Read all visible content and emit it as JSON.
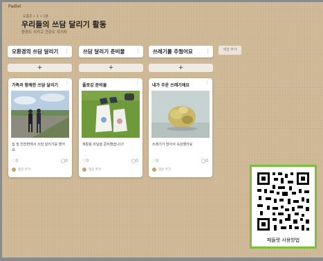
{
  "app": {
    "brand": "Padlet"
  },
  "header": {
    "breadcrumb": "오름초 • 1 • 1분",
    "title": "우리들의 쓰담 달리기 활동",
    "subtitle": "환경도 지키고 건강도 지키자"
  },
  "columns": [
    {
      "title": "오환경의 쓰담 달리기",
      "add_label": "+",
      "post": {
        "title": "가족과 함께한 쓰담 달리기",
        "body": "집 앞 천천변에서 쓰담 달리기를 했어요.",
        "likes": "0",
        "comments": "0",
        "add_comment": "댓글 추가",
        "image": "family-running-photo"
      }
    },
    {
      "title": "쓰담 달리기 준비물",
      "add_label": "+",
      "post": {
        "title": "플로깅 준비물",
        "body": "재활용 비닐을 준비했습니다!",
        "likes": "0",
        "comments": "0",
        "add_comment": "댓글 추가",
        "image": "plogging-supplies-photo"
      }
    },
    {
      "title": "쓰레기를 주웠어요",
      "add_label": "+",
      "post": {
        "title": "내가 주운 쓰레기에요",
        "body": "쓰레기가 많아서 속상했어요",
        "likes": "0",
        "comments": "0",
        "add_comment": "댓글 추가",
        "image": "trash-photo"
      }
    }
  ],
  "add_column_label": "섹션 추가",
  "qr": {
    "caption": "패들렛 사용방법"
  },
  "colors": {
    "background": "#cfb896",
    "qr_border": "#7bbf3e"
  }
}
